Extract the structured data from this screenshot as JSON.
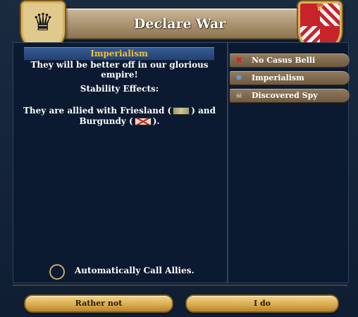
{
  "window": {
    "title": "Declare War"
  },
  "casus_belli_detail": {
    "name": "Imperialism",
    "description": "They will be better off in our glorious empire!",
    "stability_label": "Stability Effects:",
    "allies_line1_prefix": "They are allied with Friesland (",
    "allies_line1_suffix": ") and",
    "allies_line2_prefix": "Burgundy (",
    "allies_line2_suffix": ")."
  },
  "casus_belli_list": [
    {
      "label": "No Casus Belli",
      "icon": "x-icon"
    },
    {
      "label": "Imperialism",
      "icon": "globe-icon"
    },
    {
      "label": "Discovered Spy",
      "icon": "spy-icon"
    }
  ],
  "options": {
    "call_allies_label": "Automatically Call Allies."
  },
  "buttons": {
    "cancel_label": "Rather not",
    "confirm_label": "I do"
  },
  "colors": {
    "title_gold": "#f2c232",
    "button_gold": "#d6a94c",
    "panel_bg": "#0b1a30"
  }
}
